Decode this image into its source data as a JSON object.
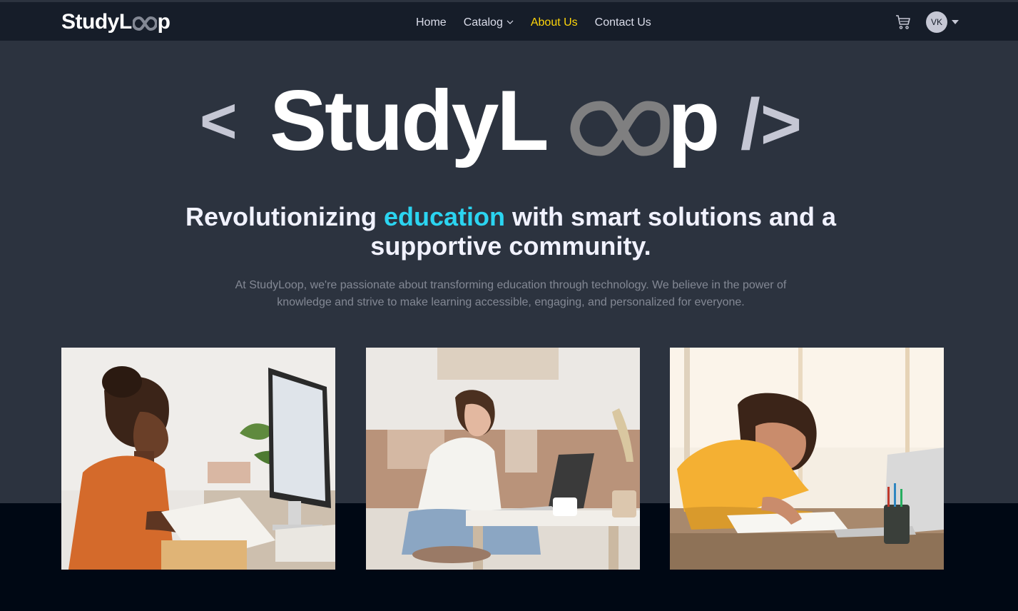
{
  "navbar": {
    "logo_main": "StudyL",
    "logo_end": "p",
    "links": [
      {
        "label": "Home"
      },
      {
        "label": "Catalog"
      },
      {
        "label": "About Us"
      },
      {
        "label": "Contact Us"
      }
    ],
    "avatar_initials": "VK",
    "cart_icon": "cart-icon"
  },
  "hero": {
    "logo_left_bracket": "<",
    "logo_main": "StudyL",
    "logo_end": "p",
    "logo_right_bracket": "/>",
    "headline_part1": "Revolutionizing ",
    "headline_highlight": "education",
    "headline_part2": " with smart solutions and a supportive community.",
    "description": "At StudyLoop, we're passionate about transforming education through technology. We believe in the power of knowledge and strive to make learning accessible, engaging, and personalized for everyone."
  },
  "colors": {
    "navbar_bg": "#161d29",
    "hero_bg": "#2c333f",
    "page_bg": "#000814",
    "active_link": "#ffd60a",
    "highlight": "#2bd4f0"
  }
}
